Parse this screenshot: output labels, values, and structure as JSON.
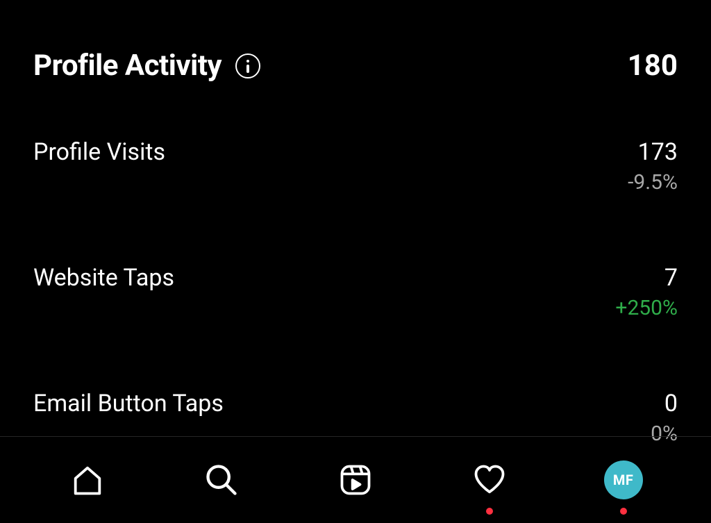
{
  "header": {
    "title": "Profile Activity",
    "total": "180"
  },
  "stats": [
    {
      "label": "Profile Visits",
      "value": "173",
      "change": "-9.5%",
      "changeClass": "change-negative"
    },
    {
      "label": "Website Taps",
      "value": "7",
      "change": "+250%",
      "changeClass": "change-positive"
    },
    {
      "label": "Email Button Taps",
      "value": "0",
      "change": "0%",
      "changeClass": "change-neutral"
    }
  ],
  "nav": {
    "avatar_initials": "MF"
  }
}
